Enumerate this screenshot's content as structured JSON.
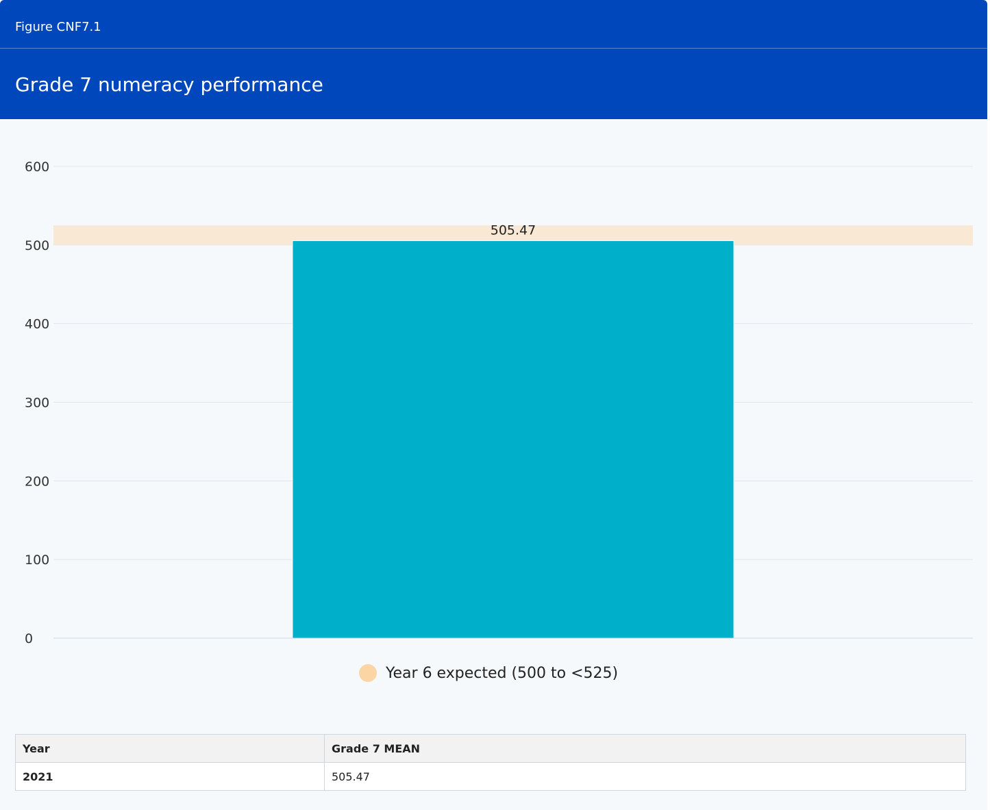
{
  "header": {
    "figure_label": "Figure CNF7.1",
    "title": "Grade 7 numeracy performance"
  },
  "chart_data": {
    "type": "bar",
    "categories": [
      "2021"
    ],
    "series": [
      {
        "name": "Grade 7 MEAN",
        "values": [
          505.47
        ],
        "color": "#00b0cb"
      }
    ],
    "data_labels": [
      "505.47"
    ],
    "ylim": [
      0,
      600
    ],
    "yticks": [
      "0",
      "100",
      "200",
      "300",
      "400",
      "500",
      "600"
    ],
    "band": {
      "name": "Year 6 expected (500 to <525)",
      "from": 500,
      "to": 525,
      "color": "#f8e8d4"
    },
    "legend": {
      "position": "bottom",
      "items": [
        {
          "label": "Year 6 expected (500 to <525)",
          "color": "#fcd5a5"
        }
      ]
    },
    "grid": true,
    "xlabel": "",
    "ylabel": ""
  },
  "table": {
    "headers": [
      "Year",
      "Grade 7 MEAN"
    ],
    "rows": [
      [
        "2021",
        "505.47"
      ]
    ]
  }
}
